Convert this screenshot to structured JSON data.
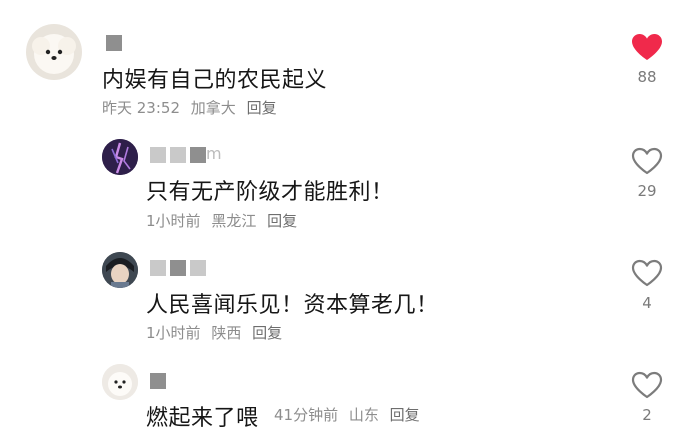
{
  "comments": [
    {
      "user_fragment": "",
      "text": "内娱有自己的农民起义",
      "time": "昨天 23:52",
      "location": "加拿大",
      "reply": "回复",
      "likes": "88",
      "liked": true,
      "like_color": "#f0294b"
    },
    {
      "user_fragment": "m",
      "text": "只有无产阶级才能胜利！",
      "time": "1小时前",
      "location": "黑龙江",
      "reply": "回复",
      "likes": "29",
      "liked": false
    },
    {
      "user_fragment": "",
      "text": "人民喜闻乐见！资本算老几！",
      "time": "1小时前",
      "location": "陕西",
      "reply": "回复",
      "likes": "4",
      "liked": false
    },
    {
      "user_fragment": "",
      "text": "燃起来了喂",
      "time": "41分钟前",
      "location": "山东",
      "reply": "回复",
      "likes": "2",
      "liked": false
    }
  ]
}
